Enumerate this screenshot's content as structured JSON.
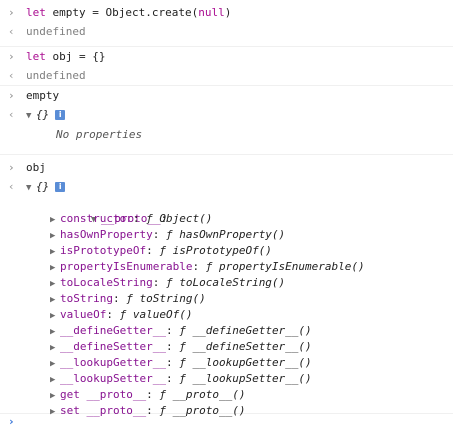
{
  "console": {
    "commands": [
      {
        "input_prefix": "let empty = Object.create(",
        "input_keyword": "null",
        "input_suffix": ")",
        "result": "undefined"
      },
      {
        "input": "let obj = {}",
        "result": "undefined"
      },
      {
        "input": "empty",
        "result_object": "{}",
        "children_text": "No properties"
      },
      {
        "input": "obj",
        "result_object": "{}"
      }
    ],
    "proto_label": "__proto__",
    "proto_members": [
      {
        "key": "constructor",
        "fn": "Object()"
      },
      {
        "key": "hasOwnProperty",
        "fn": "hasOwnProperty()"
      },
      {
        "key": "isPrototypeOf",
        "fn": "isPrototypeOf()"
      },
      {
        "key": "propertyIsEnumerable",
        "fn": "propertyIsEnumerable()"
      },
      {
        "key": "toLocaleString",
        "fn": "toLocaleString()"
      },
      {
        "key": "toString",
        "fn": "toString()"
      },
      {
        "key": "valueOf",
        "fn": "valueOf()"
      },
      {
        "key": "__defineGetter__",
        "fn": "__defineGetter__()"
      },
      {
        "key": "__defineSetter__",
        "fn": "__defineSetter__()"
      },
      {
        "key": "__lookupGetter__",
        "fn": "__lookupGetter__()"
      },
      {
        "key": "__lookupSetter__",
        "fn": "__lookupSetter__()"
      },
      {
        "key": "get __proto__",
        "fn": "__proto__()"
      },
      {
        "key": "set __proto__",
        "fn": "__proto__()"
      }
    ],
    "f_symbol": "ƒ",
    "info_icon_glyph": "i",
    "prompt_glyph": "›",
    "result_glyph": "‹"
  }
}
